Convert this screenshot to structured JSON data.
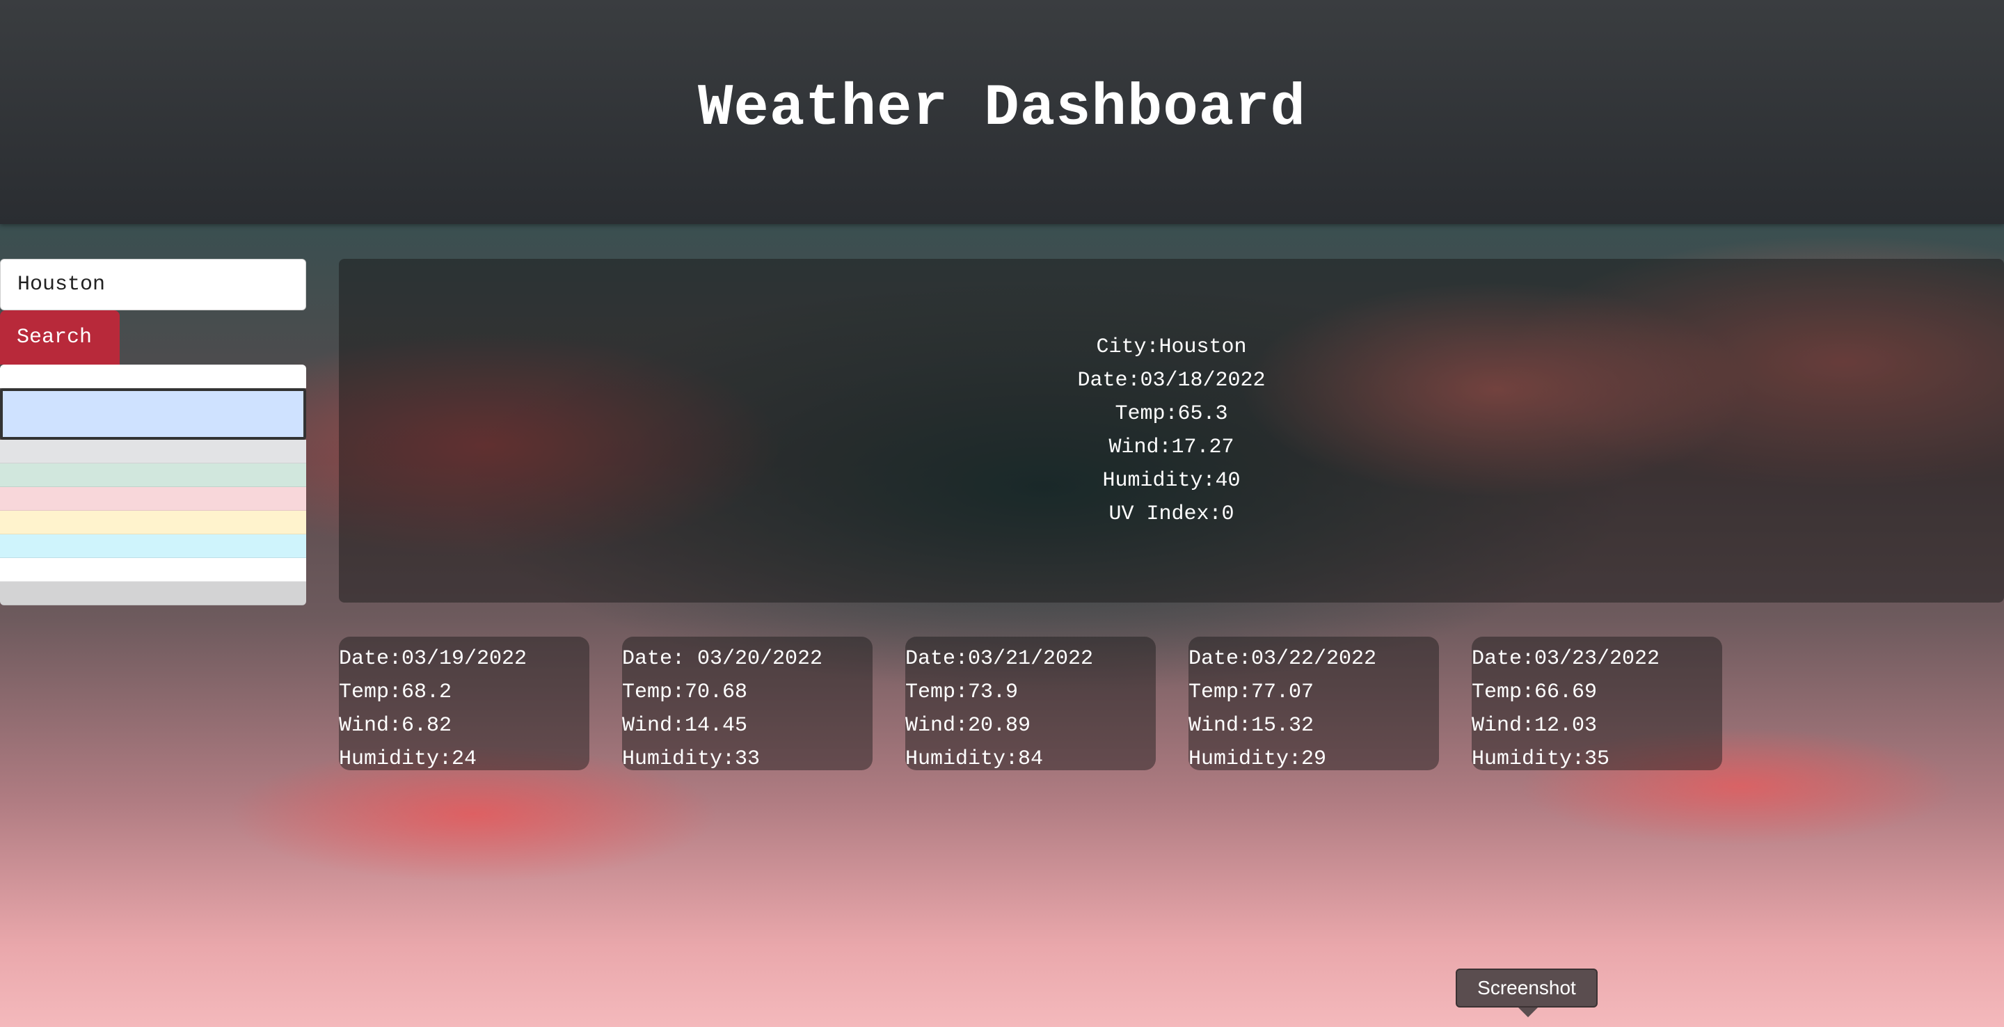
{
  "header": {
    "title": "Weather Dashboard"
  },
  "search": {
    "value": "Houston",
    "button_label": "Search"
  },
  "history": {
    "items": [
      {
        "color": "#ffffff",
        "type": "default"
      },
      {
        "color": "#cfe2ff",
        "type": "active"
      },
      {
        "color": "#e2e3e5",
        "type": "secondary"
      },
      {
        "color": "#d1e7dd",
        "type": "success"
      },
      {
        "color": "#f8d7da",
        "type": "danger"
      },
      {
        "color": "#fff3cd",
        "type": "warning"
      },
      {
        "color": "#cff4fc",
        "type": "info"
      },
      {
        "color": "#ffffff",
        "type": "light"
      },
      {
        "color": "#d3d3d4",
        "type": "dark"
      }
    ]
  },
  "today": {
    "city": "City:Houston",
    "date": "Date:03/18/2022",
    "temp": "Temp:65.3",
    "wind": "Wind:17.27",
    "humidity": "Humidity:40",
    "uv": "UV Index:0"
  },
  "forecast": [
    {
      "date": "Date:03/19/2022",
      "temp": "Temp:68.2",
      "wind": "Wind:6.82",
      "humidity": "Humidity:24"
    },
    {
      "date": "Date: 03/20/2022",
      "temp": "Temp:70.68",
      "wind": "Wind:14.45",
      "humidity": "Humidity:33"
    },
    {
      "date": "Date:03/21/2022",
      "temp": "Temp:73.9",
      "wind": "Wind:20.89",
      "humidity": "Humidity:84"
    },
    {
      "date": "Date:03/22/2022",
      "temp": "Temp:77.07",
      "wind": "Wind:15.32",
      "humidity": "Humidity:29"
    },
    {
      "date": "Date:03/23/2022",
      "temp": "Temp:66.69",
      "wind": "Wind:12.03",
      "humidity": "Humidity:35"
    }
  ],
  "tooltip": {
    "label": "Screenshot"
  }
}
